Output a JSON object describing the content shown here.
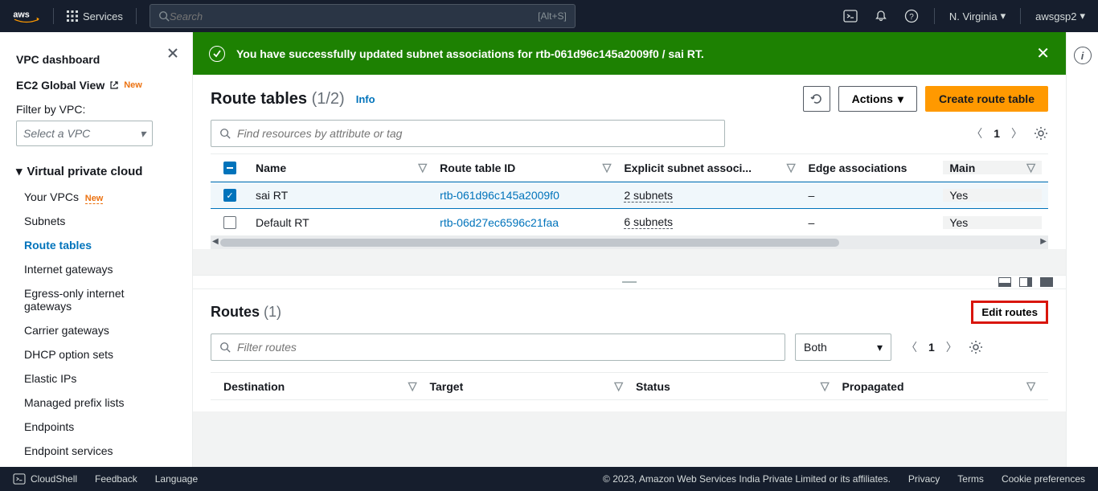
{
  "topnav": {
    "services": "Services",
    "search_placeholder": "Search",
    "search_kbd": "[Alt+S]",
    "region": "N. Virginia",
    "account": "awsgsp2"
  },
  "sidebar": {
    "dashboard": "VPC dashboard",
    "ec2": "EC2 Global View",
    "new": "New",
    "filter_label": "Filter by VPC:",
    "vpc_select_placeholder": "Select a VPC",
    "vpc_sec": "Virtual private cloud",
    "items": [
      {
        "label": "Your VPCs",
        "new": true
      },
      {
        "label": "Subnets"
      },
      {
        "label": "Route tables",
        "active": true
      },
      {
        "label": "Internet gateways"
      },
      {
        "label": "Egress-only internet gateways"
      },
      {
        "label": "Carrier gateways"
      },
      {
        "label": "DHCP option sets"
      },
      {
        "label": "Elastic IPs"
      },
      {
        "label": "Managed prefix lists"
      },
      {
        "label": "Endpoints"
      },
      {
        "label": "Endpoint services"
      }
    ]
  },
  "flash": {
    "message": "You have successfully updated subnet associations for rtb-061d96c145a2009f0 / sai RT."
  },
  "rt_panel": {
    "title": "Route tables",
    "count": "(1/2)",
    "info": "Info",
    "actions_label": "Actions",
    "create_label": "Create route table",
    "search_placeholder": "Find resources by attribute or tag",
    "page": "1",
    "columns": {
      "name": "Name",
      "id": "Route table ID",
      "subn": "Explicit subnet associ...",
      "edge": "Edge associations",
      "main": "Main"
    },
    "rows": [
      {
        "name": "sai RT",
        "id": "rtb-061d96c145a2009f0",
        "sub": "2 subnets",
        "edge": "–",
        "main": "Yes",
        "checked": true
      },
      {
        "name": "Default RT",
        "id": "rtb-06d27ec6596c21faa",
        "sub": "6 subnets",
        "edge": "–",
        "main": "Yes",
        "checked": false
      }
    ]
  },
  "detail": {
    "title": "Routes",
    "count": "(1)",
    "edit_label": "Edit routes",
    "filter_placeholder": "Filter routes",
    "both": "Both",
    "page": "1",
    "columns": {
      "dest": "Destination",
      "target": "Target",
      "status": "Status",
      "prop": "Propagated"
    }
  },
  "footer": {
    "cloudshell": "CloudShell",
    "feedback": "Feedback",
    "language": "Language",
    "copyright": "© 2023, Amazon Web Services India Private Limited or its affiliates.",
    "privacy": "Privacy",
    "terms": "Terms",
    "cookie": "Cookie preferences"
  }
}
